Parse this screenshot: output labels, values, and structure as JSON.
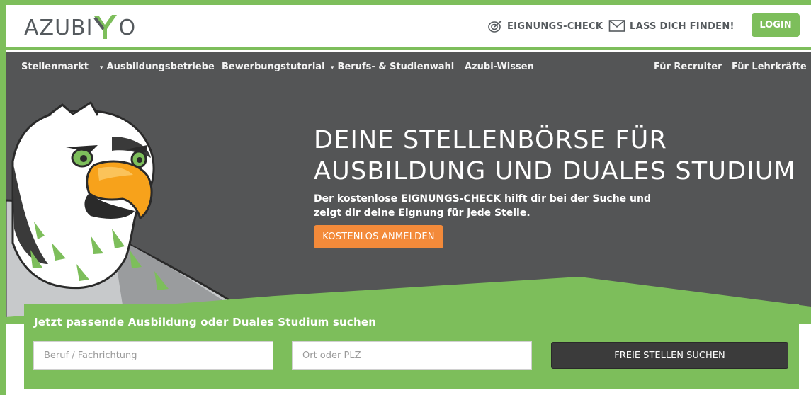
{
  "header": {
    "logo_text_left": "AZUBI",
    "logo_text_right": "O",
    "links": [
      {
        "label": "EIGNUNGS-CHECK",
        "icon": "target-icon"
      },
      {
        "label": "LASS DICH FINDEN!",
        "icon": "envelope-icon"
      }
    ],
    "login_label": "LOGIN"
  },
  "nav": {
    "items": [
      {
        "label": "Stellenmarkt",
        "has_dropdown": false
      },
      {
        "label": "Ausbildungsbetriebe",
        "has_dropdown": true
      },
      {
        "label": "Bewerbungstutorial",
        "has_dropdown": false
      },
      {
        "label": "Berufs- & Studienwahl",
        "has_dropdown": true
      },
      {
        "label": "Azubi-Wissen",
        "has_dropdown": false
      }
    ],
    "right_items": [
      {
        "label": "Für Recruiter"
      },
      {
        "label": "Für Lehrkräfte"
      }
    ]
  },
  "hero": {
    "title_line1": "DEINE STELLENBÖRSE FÜR",
    "title_line2": "AUSBILDUNG UND DUALES STUDIUM",
    "subtitle_line1": "Der kostenlose EIGNUNGS-CHECK hilft dir bei der Suche und",
    "subtitle_line2": "zeigt dir deine Eignung für jede Stelle.",
    "cta_label": "KOSTENLOS ANMELDEN",
    "mascot_icon": "eagle-mascot-icon"
  },
  "search": {
    "title": "Jetzt passende Ausbildung oder Duales Studium suchen",
    "job_placeholder": "Beruf / Fachrichtung",
    "job_value": "",
    "location_placeholder": "Ort oder PLZ",
    "location_value": "",
    "submit_label": "FREIE STELLEN SUCHEN"
  },
  "colors": {
    "brand_green": "#7dbe5b",
    "hero_dark": "#545556",
    "cta_orange": "#f38a3a",
    "search_button": "#3b3b3b",
    "text_gray": "#555a5e"
  }
}
